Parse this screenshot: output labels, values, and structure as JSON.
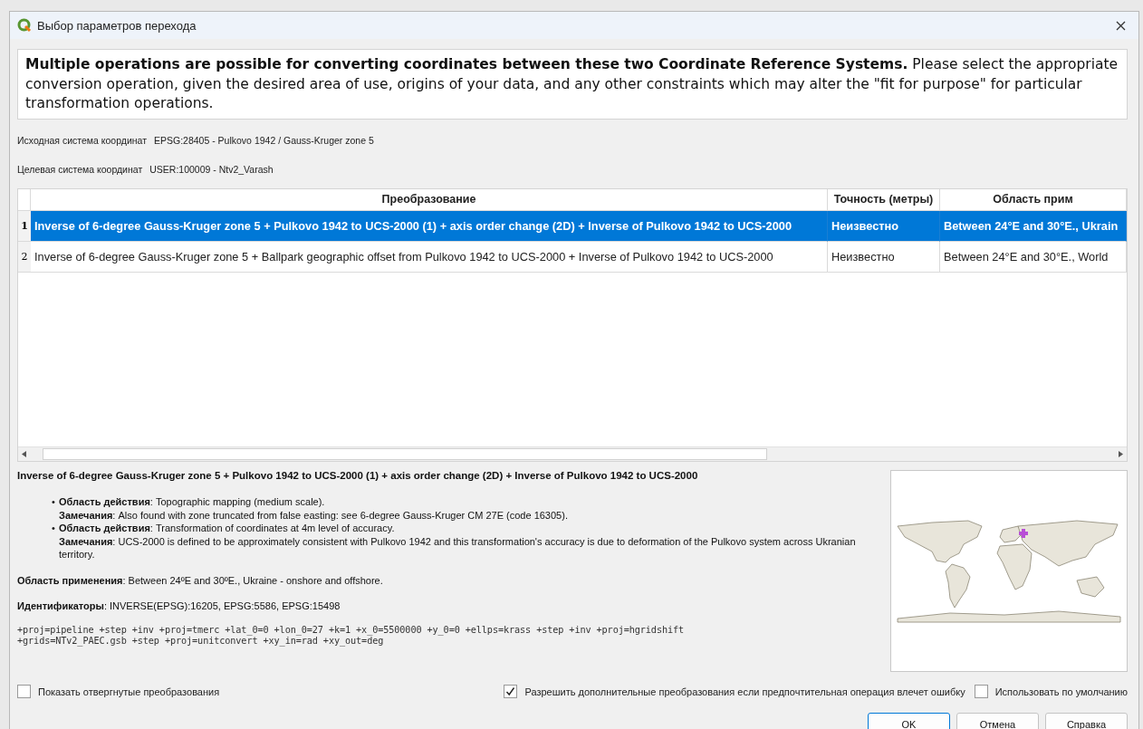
{
  "window": {
    "title": "Выбор параметров перехода"
  },
  "intro": "**Multiple operations are possible for converting coordinates between these two Coordinate Reference Systems.** Please select the appropriate conversion operation, given the desired area of use, origins of your data, and any other constraints which may alter the \"fit for purpose\" for particular transformation operations.",
  "crs": [
    {
      "label": "Исходная система координат",
      "value": "EPSG:28405 - Pulkovo 1942 / Gauss-Kruger zone 5"
    },
    {
      "label": "Целевая система координат",
      "value": "USER:100009 - Ntv2_Varash"
    }
  ],
  "table": {
    "columns": [
      "Преобразование",
      "Точность (метры)",
      "Область прим"
    ],
    "rows": [
      {
        "number": "1",
        "selected": true,
        "cells": [
          "Inverse of 6-degree Gauss-Kruger zone 5 + Pulkovo 1942 to UCS-2000 (1) + axis order change (2D) + Inverse of Pulkovo 1942 to UCS-2000",
          "Неизвестно",
          "Between 24°E and 30°E., Ukrain"
        ]
      },
      {
        "number": "2",
        "selected": false,
        "cells": [
          "Inverse of 6-degree Gauss-Kruger zone 5 + Ballpark geographic offset from Pulkovo 1942 to UCS-2000 + Inverse of Pulkovo 1942 to UCS-2000",
          "Неизвестно",
          "Between 24°E and 30°E., World"
        ]
      }
    ]
  },
  "details": {
    "title": "Inverse of 6-degree Gauss-Kruger zone 5 + Pulkovo 1942 to UCS-2000 (1) + axis order change (2D) + Inverse of Pulkovo 1942 to UCS-2000",
    "items": [
      {
        "marker": "•",
        "scope": "**Область действия**: Topographic mapping (medium scale).",
        "remarks": "**Замечания**: Also found with zone truncated from false easting: see 6-degree Gauss-Kruger CM 27E (code 16305)."
      },
      {
        "marker": "•",
        "scope": "**Область действия**: Transformation of coordinates at 4m level of accuracy.",
        "remarks": "**Замечания**: UCS-2000 is defined to be approximately consistent with Pulkovo 1942 and this transformation's accuracy is due to deformation of the Pulkovo system across Ukranian territory."
      }
    ],
    "area": "**Область применения**: Between 24ºE and 30ºE., Ukraine - onshore and offshore.",
    "identifiers": "**Идентификаторы**: INVERSE(EPSG):16205, EPSG:5586, EPSG:15498",
    "proj": [
      "+proj=pipeline +step +inv +proj=tmerc +lat_0=0 +lon_0=27 +k=1 +x_0=5500000 +y_0=0 +ellps=krass +step +inv +proj=hgridshift",
      "+grids=NTv2_PAEC.gsb +step +proj=unitconvert +xy_in=rad +xy_out=deg"
    ]
  },
  "options": [
    {
      "label": "Показать отвергнутые преобразования",
      "checked": false
    },
    {
      "label": "Разрешить дополнительные преобразования если предпочтительная операция влечет ошибку",
      "checked": true
    },
    {
      "label": "Использовать по умолчанию",
      "checked": false
    }
  ],
  "buttons": [
    {
      "label": "OK",
      "default": true
    },
    {
      "label": "Отмена",
      "default": false
    },
    {
      "label": "Справка",
      "default": false
    }
  ]
}
